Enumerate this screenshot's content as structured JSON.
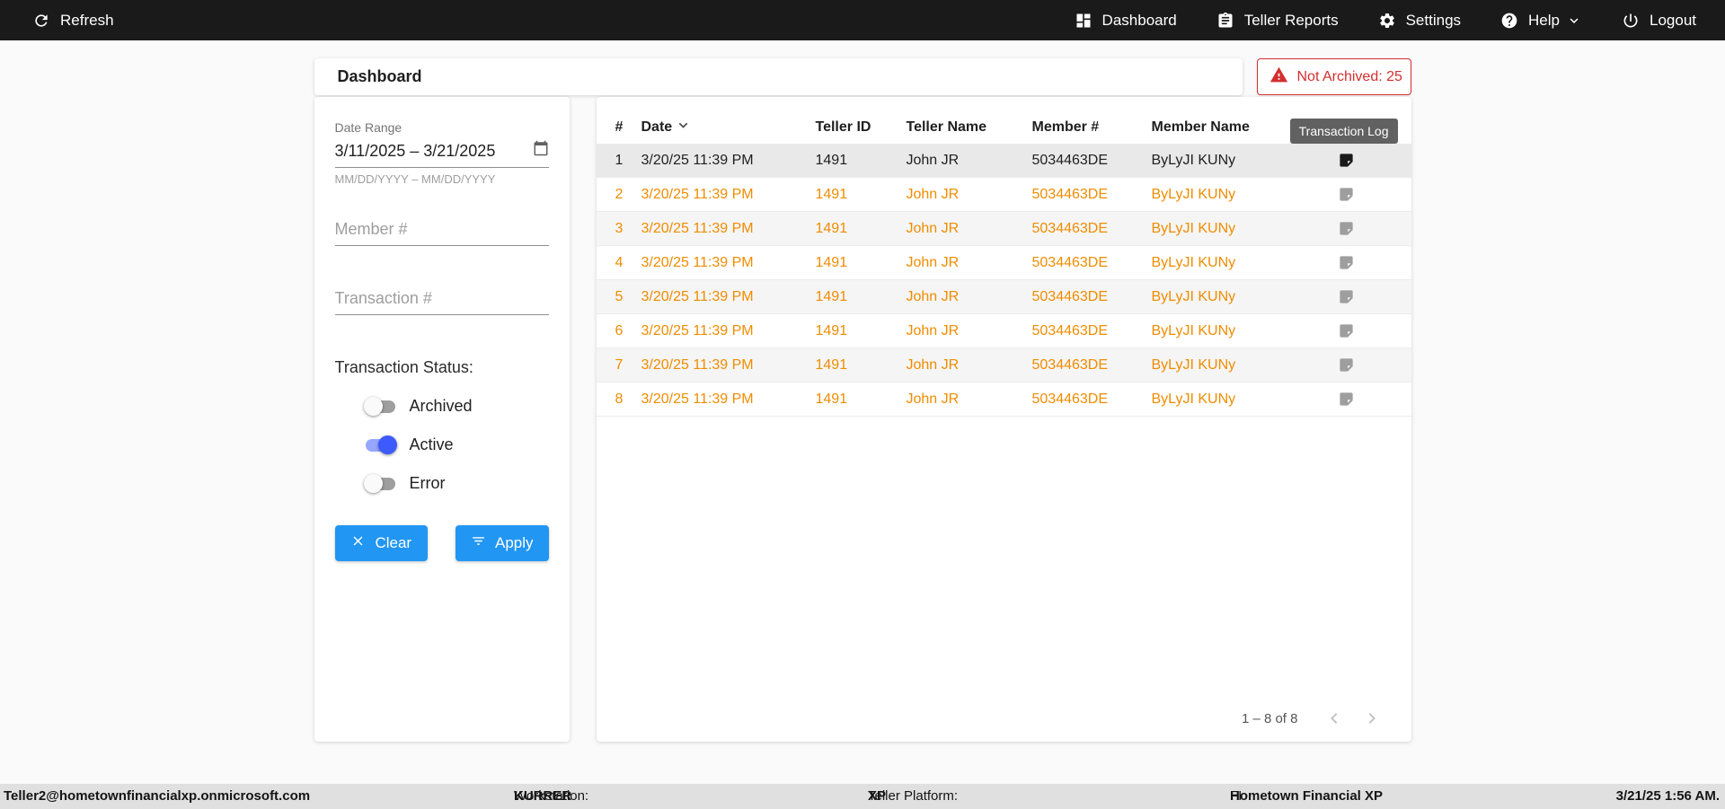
{
  "topbar": {
    "refresh_label": "Refresh",
    "nav": [
      {
        "label": "Dashboard",
        "icon": "dashboard-icon"
      },
      {
        "label": "Teller Reports",
        "icon": "teller-reports-icon"
      },
      {
        "label": "Settings",
        "icon": "settings-icon"
      },
      {
        "label": "Help",
        "icon": "help-icon",
        "has_dropdown": true
      },
      {
        "label": "Logout",
        "icon": "logout-icon"
      }
    ]
  },
  "header": {
    "title": "Dashboard",
    "badge_label": "Not Archived: 25"
  },
  "filters": {
    "date_range": {
      "label": "Date Range",
      "value": "3/11/2025 – 3/21/2025",
      "helper": "MM/DD/YYYY – MM/DD/YYYY"
    },
    "member_placeholder": "Member #",
    "transaction_placeholder": "Transaction #",
    "status_label": "Transaction Status:",
    "toggles": [
      {
        "label": "Archived",
        "on": false
      },
      {
        "label": "Active",
        "on": true
      },
      {
        "label": "Error",
        "on": false
      }
    ],
    "clear_label": "Clear",
    "apply_label": "Apply"
  },
  "table": {
    "columns": [
      "#",
      "Date",
      "Teller ID",
      "Teller Name",
      "Member #",
      "Member Name"
    ],
    "tooltip": "Transaction Log",
    "rows": [
      {
        "num": "1",
        "date": "3/20/25 11:39 PM",
        "teller_id": "1491",
        "teller_name": "John JR",
        "member_num": "5034463DE",
        "member_name": "ByLyJI KUNy",
        "tone": "default"
      },
      {
        "num": "2",
        "date": "3/20/25 11:39 PM",
        "teller_id": "1491",
        "teller_name": "John JR",
        "member_num": "5034463DE",
        "member_name": "ByLyJI KUNy",
        "tone": "warning"
      },
      {
        "num": "3",
        "date": "3/20/25 11:39 PM",
        "teller_id": "1491",
        "teller_name": "John JR",
        "member_num": "5034463DE",
        "member_name": "ByLyJI KUNy",
        "tone": "warning"
      },
      {
        "num": "4",
        "date": "3/20/25 11:39 PM",
        "teller_id": "1491",
        "teller_name": "John JR",
        "member_num": "5034463DE",
        "member_name": "ByLyJI KUNy",
        "tone": "warning"
      },
      {
        "num": "5",
        "date": "3/20/25 11:39 PM",
        "teller_id": "1491",
        "teller_name": "John JR",
        "member_num": "5034463DE",
        "member_name": "ByLyJI KUNy",
        "tone": "warning"
      },
      {
        "num": "6",
        "date": "3/20/25 11:39 PM",
        "teller_id": "1491",
        "teller_name": "John JR",
        "member_num": "5034463DE",
        "member_name": "ByLyJI KUNy",
        "tone": "warning"
      },
      {
        "num": "7",
        "date": "3/20/25 11:39 PM",
        "teller_id": "1491",
        "teller_name": "John JR",
        "member_num": "5034463DE",
        "member_name": "ByLyJI KUNy",
        "tone": "warning"
      },
      {
        "num": "8",
        "date": "3/20/25 11:39 PM",
        "teller_id": "1491",
        "teller_name": "John JR",
        "member_num": "5034463DE",
        "member_name": "ByLyJI KUNy",
        "tone": "warning"
      }
    ],
    "pagination": {
      "range": "1 – 8 of 8"
    }
  },
  "footer": {
    "user": "Teller2@hometownfinancialxp.onmicrosoft.com",
    "workstation_label": "Workstation:",
    "workstation_value": "KURRER",
    "platform_label": "Teller Platform:",
    "platform_value": "XP",
    "fi_label": "FI:",
    "fi_value": "Hometown Financial XP",
    "timestamp": "3/21/25 1:56 AM."
  },
  "icons": {
    "refresh": "refresh-arrow",
    "dashboard": "grid-tiles",
    "teller_reports": "clipboard",
    "settings": "gear",
    "help": "question-circle",
    "logout": "power",
    "not_archived": "warning-triangle",
    "date_range": "calendar",
    "clear": "x-mark",
    "apply": "filter-lines",
    "date_sort": "chevron-down",
    "transaction_log": "note-folded-corner",
    "pagination_prev": "chevron-left",
    "pagination_next": "chevron-right"
  },
  "colors": {
    "topbar_bg": "#1a1a1a",
    "accent_blue": "#2196f3",
    "toggle_active": "#3d5afe",
    "warning_orange": "#f08c00",
    "alert_red": "#d32f2f",
    "tooltip_bg": "#616161",
    "footer_bg": "#e0e0e0"
  }
}
